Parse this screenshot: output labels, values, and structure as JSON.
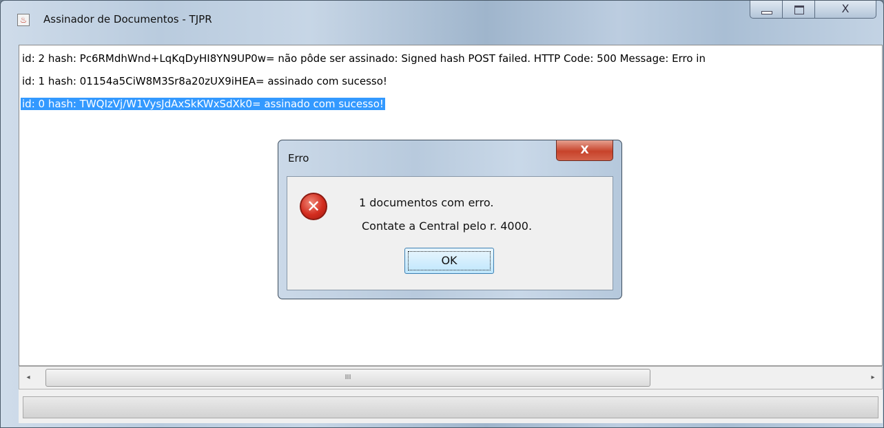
{
  "window": {
    "title": "Assinador de Documentos - TJPR",
    "controls": {
      "close_glyph": "X"
    }
  },
  "log": {
    "lines": [
      "id: 2 hash: Pc6RMdhWnd+LqKqDyHI8YN9UP0w= não pôde ser assinado: Signed hash POST failed. HTTP Code: 500 Message: Erro in",
      "id: 1 hash: 01154a5CiW8M3Sr8a20zUX9iHEA= assinado com sucesso!",
      "id: 0 hash: TWQIzVj/W1VysJdAxSkKWxSdXk0= assinado com sucesso!"
    ],
    "selected_index": 2
  },
  "scrollbar": {
    "left_arrow": "◂",
    "right_arrow": "▸",
    "grip": "III"
  },
  "dialog": {
    "title": "Erro",
    "close_glyph": "X",
    "icon": "error-icon",
    "message_line1": "1 documentos com erro.",
    "message_line2": "Contate a Central pelo r. 4000.",
    "ok_label": "OK"
  },
  "colors": {
    "selection": "#3399ff",
    "dialog_close": "#c7432b"
  }
}
